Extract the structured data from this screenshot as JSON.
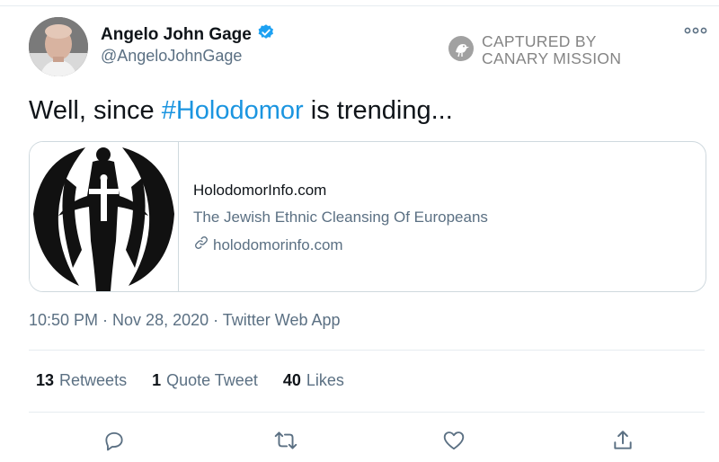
{
  "tweet": {
    "author": {
      "display_name": "Angelo John Gage",
      "handle": "@AngeloJohnGage",
      "verified": true
    },
    "text_prefix": "Well, since ",
    "hashtag": "#Holodomor",
    "text_suffix": " is trending...",
    "link_card": {
      "title": "HolodomorInfo.com",
      "description": "The Jewish Ethnic Cleansing Of Europeans",
      "domain": "holodomorinfo.com"
    },
    "time": "10:50 PM",
    "date": "Nov 28, 2020",
    "source": "Twitter Web App",
    "stats": {
      "retweets_count": "13",
      "retweets_label": "Retweets",
      "quotes_count": "1",
      "quotes_label": "Quote Tweet",
      "likes_count": "40",
      "likes_label": "Likes"
    }
  },
  "watermark": {
    "line1": "CAPTURED BY",
    "line2": "CANARY MISSION"
  },
  "colors": {
    "accent": "#1b95e0",
    "verified": "#1da1f2",
    "secondary_text": "#5b7083",
    "border": "#cfd9de"
  },
  "icons": [
    "verified-badge-icon",
    "more-icon",
    "link-icon",
    "reply-icon",
    "retweet-icon",
    "like-icon",
    "share-icon",
    "canary-icon"
  ]
}
